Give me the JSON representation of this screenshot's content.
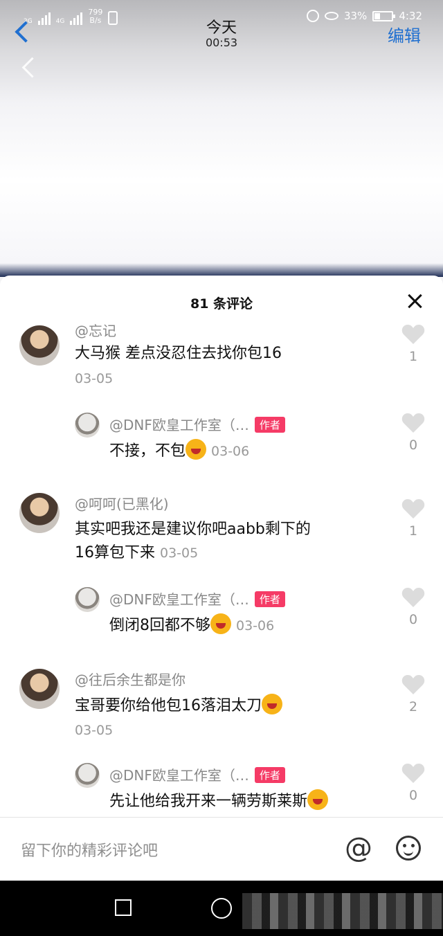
{
  "status_bar": {
    "net1": "2G",
    "net2": "4G",
    "speed_value": "799",
    "speed_unit": "B/s",
    "battery": "33%",
    "time": "4:32"
  },
  "header": {
    "title": "今天",
    "subtitle": "00:53",
    "edit_label": "编辑"
  },
  "sheet": {
    "title": "81 条评论"
  },
  "comments": [
    {
      "user": "@忘记",
      "text": "大马猴 差点没忍住去找你包16",
      "date": "03-05",
      "likes": "1"
    },
    {
      "user": "@DNF欧皇工作室（…",
      "tag": "作者",
      "text": "不接，不包",
      "date": "03-06",
      "likes": "0"
    },
    {
      "user": "@呵呵(已黑化)",
      "text_line1": "其实吧我还是建议你吧aabb剩下的",
      "text_line2": "16算包下来",
      "date": "03-05",
      "likes": "1"
    },
    {
      "user": "@DNF欧皇工作室（…",
      "tag": "作者",
      "text": "倒闭8回都不够",
      "date": "03-06",
      "likes": "0"
    },
    {
      "user": "@往后余生都是你",
      "text": "宝哥要你给他包16落泪太刀",
      "date": "03-05",
      "likes": "2"
    },
    {
      "user": "@DNF欧皇工作室（…",
      "tag": "作者",
      "text": "先让他给我开来一辆劳斯莱斯",
      "likes": "0"
    }
  ],
  "input": {
    "placeholder": "留下你的精彩评论吧",
    "at_symbol": "@"
  }
}
